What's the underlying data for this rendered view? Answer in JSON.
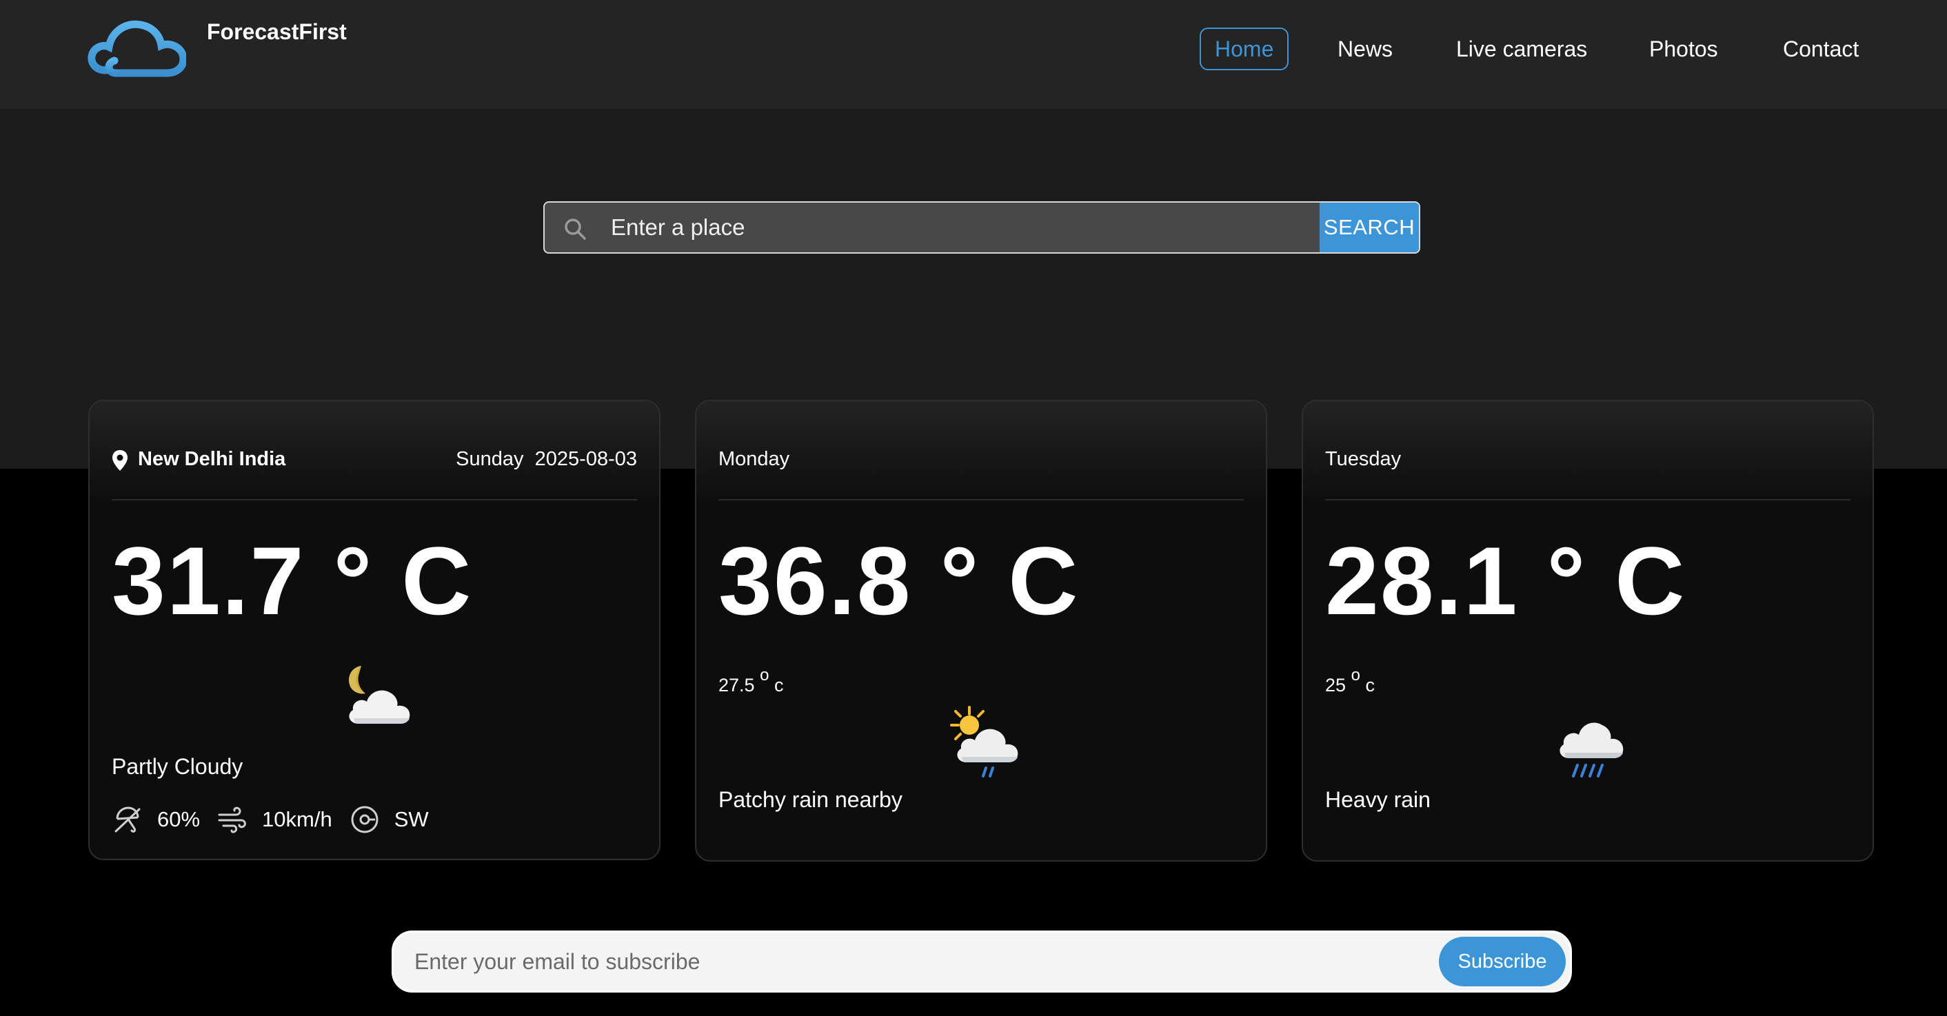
{
  "header": {
    "brand": "ForecastFirst",
    "nav": [
      {
        "label": "Home",
        "active": true
      },
      {
        "label": "News"
      },
      {
        "label": "Live cameras"
      },
      {
        "label": "Photos"
      },
      {
        "label": "Contact"
      }
    ]
  },
  "search": {
    "placeholder": "Enter a place",
    "button": "SEARCH"
  },
  "current": {
    "location": "New Delhi India",
    "day": "Sunday",
    "date": "2025-08-03",
    "temp": "31.7 ° C",
    "condition": "Partly Cloudy",
    "icon": "moon-cloud-icon",
    "humidity": "60%",
    "wind_speed": "10km/h",
    "wind_dir": "SW"
  },
  "forecast": [
    {
      "day": "Monday",
      "temp": "36.8 ° C",
      "min_temp": "27.5",
      "min_unit_deg": "o",
      "min_unit": "c",
      "condition": "Patchy rain nearby",
      "icon": "sun-rain-cloud-icon"
    },
    {
      "day": "Tuesday",
      "temp": "28.1 ° C",
      "min_temp": "25",
      "min_unit_deg": "o",
      "min_unit": "c",
      "condition": "Heavy rain",
      "icon": "heavy-rain-cloud-icon"
    }
  ],
  "subscribe": {
    "placeholder": "Enter your email to subscribe",
    "button": "Subscribe"
  },
  "colors": {
    "accent": "#3c95d6",
    "header_bg": "#242424",
    "hero_bg": "#1c1c1c",
    "page_bg": "#000000",
    "card_bg": "#0d0d0d"
  }
}
